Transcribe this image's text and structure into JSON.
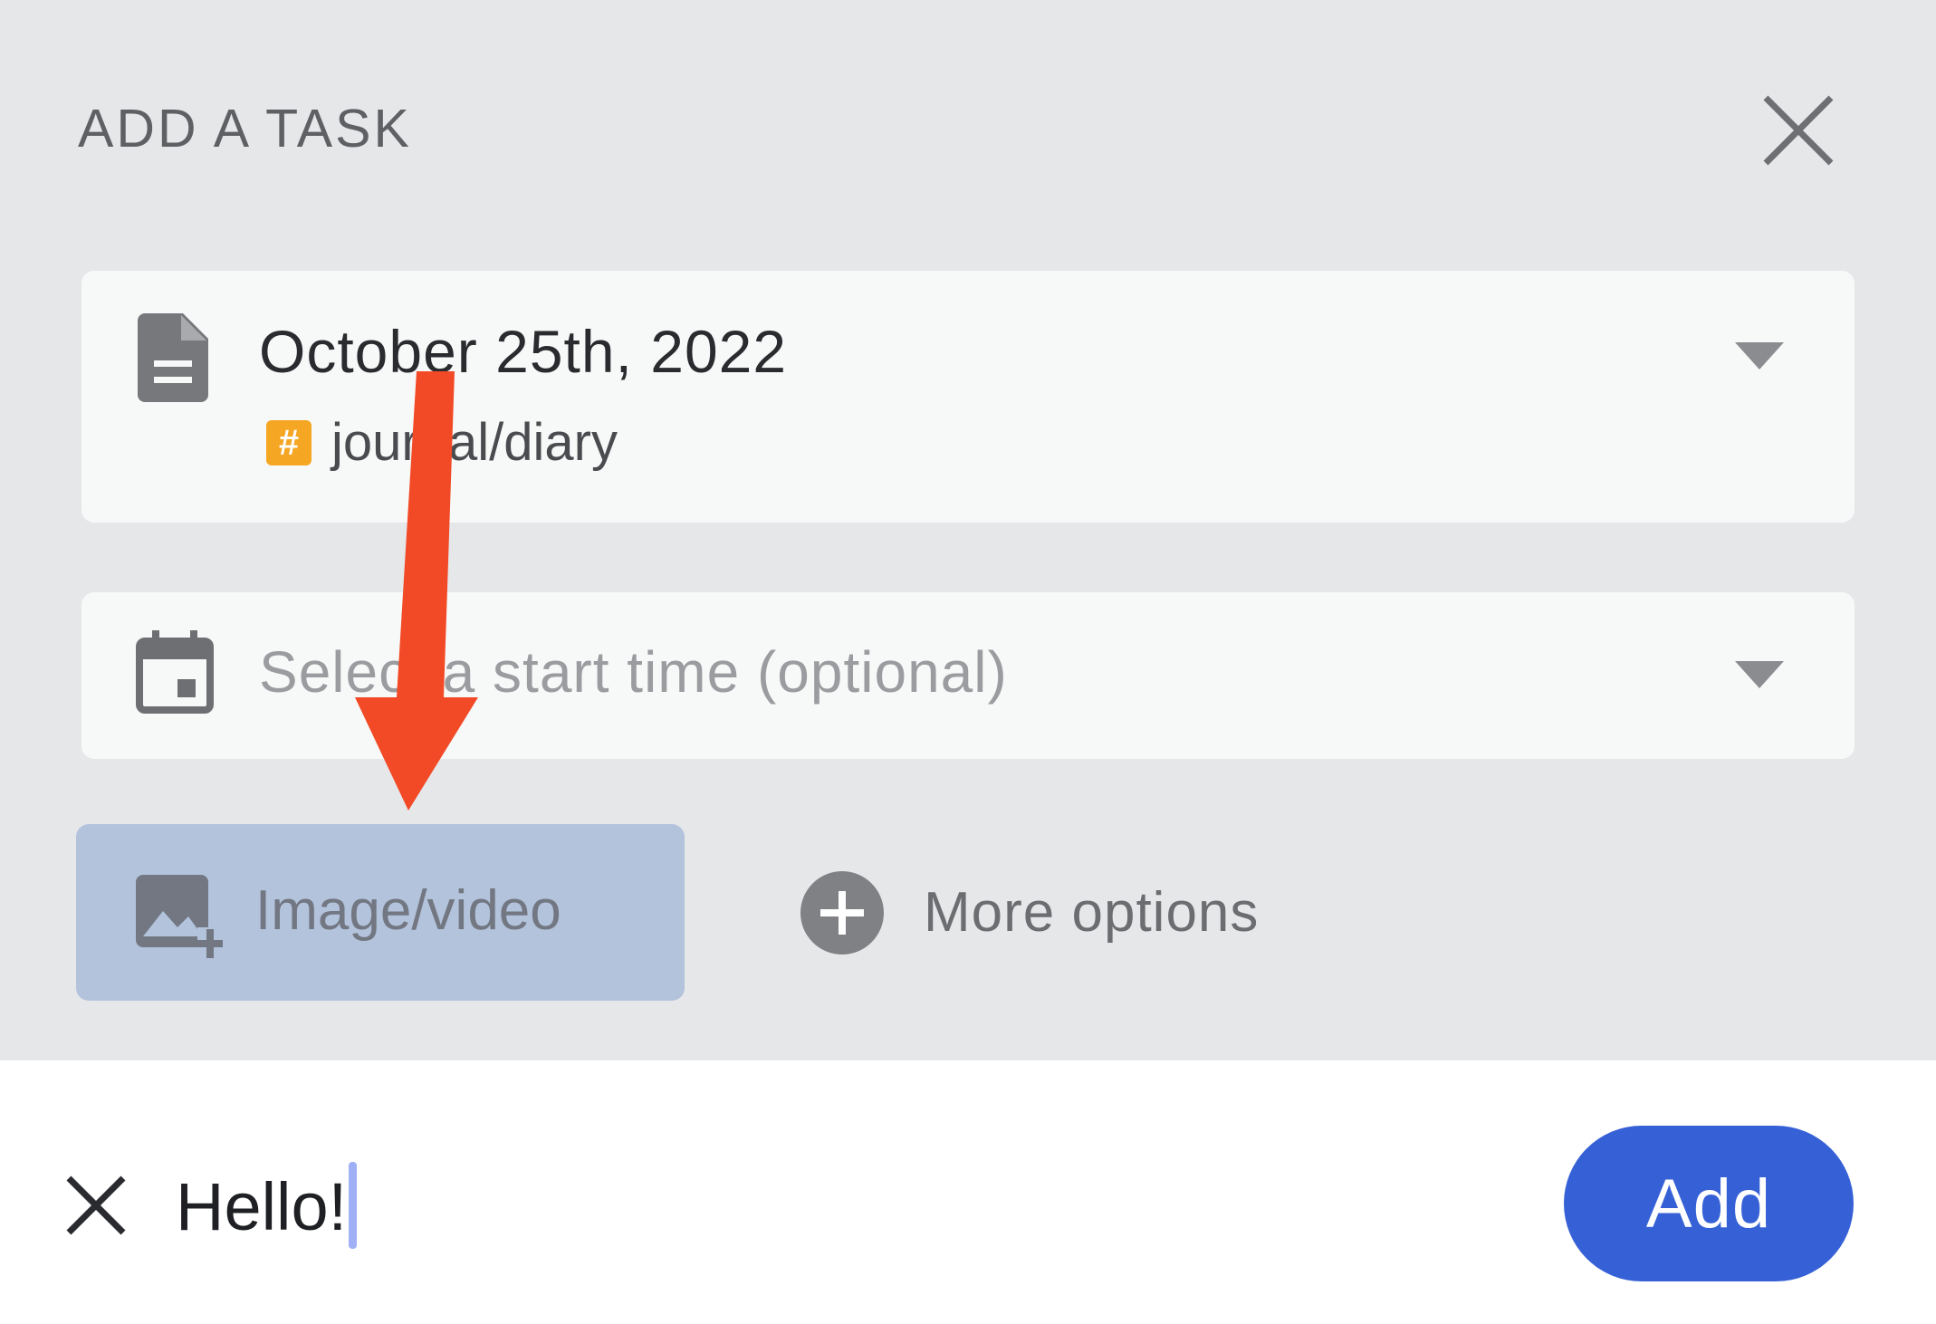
{
  "header": {
    "title": "ADD A TASK",
    "close_icon": "close-icon"
  },
  "journal_card": {
    "icon": "document-icon",
    "date": "October 25th, 2022",
    "tag_icon": "hashtag-icon",
    "tag_symbol": "#",
    "tag": "journal/diary",
    "dropdown_icon": "chevron-down-icon"
  },
  "time_card": {
    "icon": "calendar-icon",
    "placeholder": "Select a start time (optional)",
    "dropdown_icon": "chevron-down-icon"
  },
  "actions": {
    "media_label": "Image/video",
    "media_icon": "add-photo-icon",
    "more_label": "More options",
    "more_icon": "plus-circle-icon"
  },
  "bottom": {
    "clear_icon": "close-icon",
    "input_value": "Hello!",
    "add_label": "Add"
  },
  "colors": {
    "panel_bg": "#e6e7e9",
    "card_bg": "#f7f8f8",
    "media_button_bg": "#b3c3dc",
    "tag_orange": "#f5a623",
    "accent_blue": "#3661d6",
    "annotation_red": "#f24a26"
  }
}
